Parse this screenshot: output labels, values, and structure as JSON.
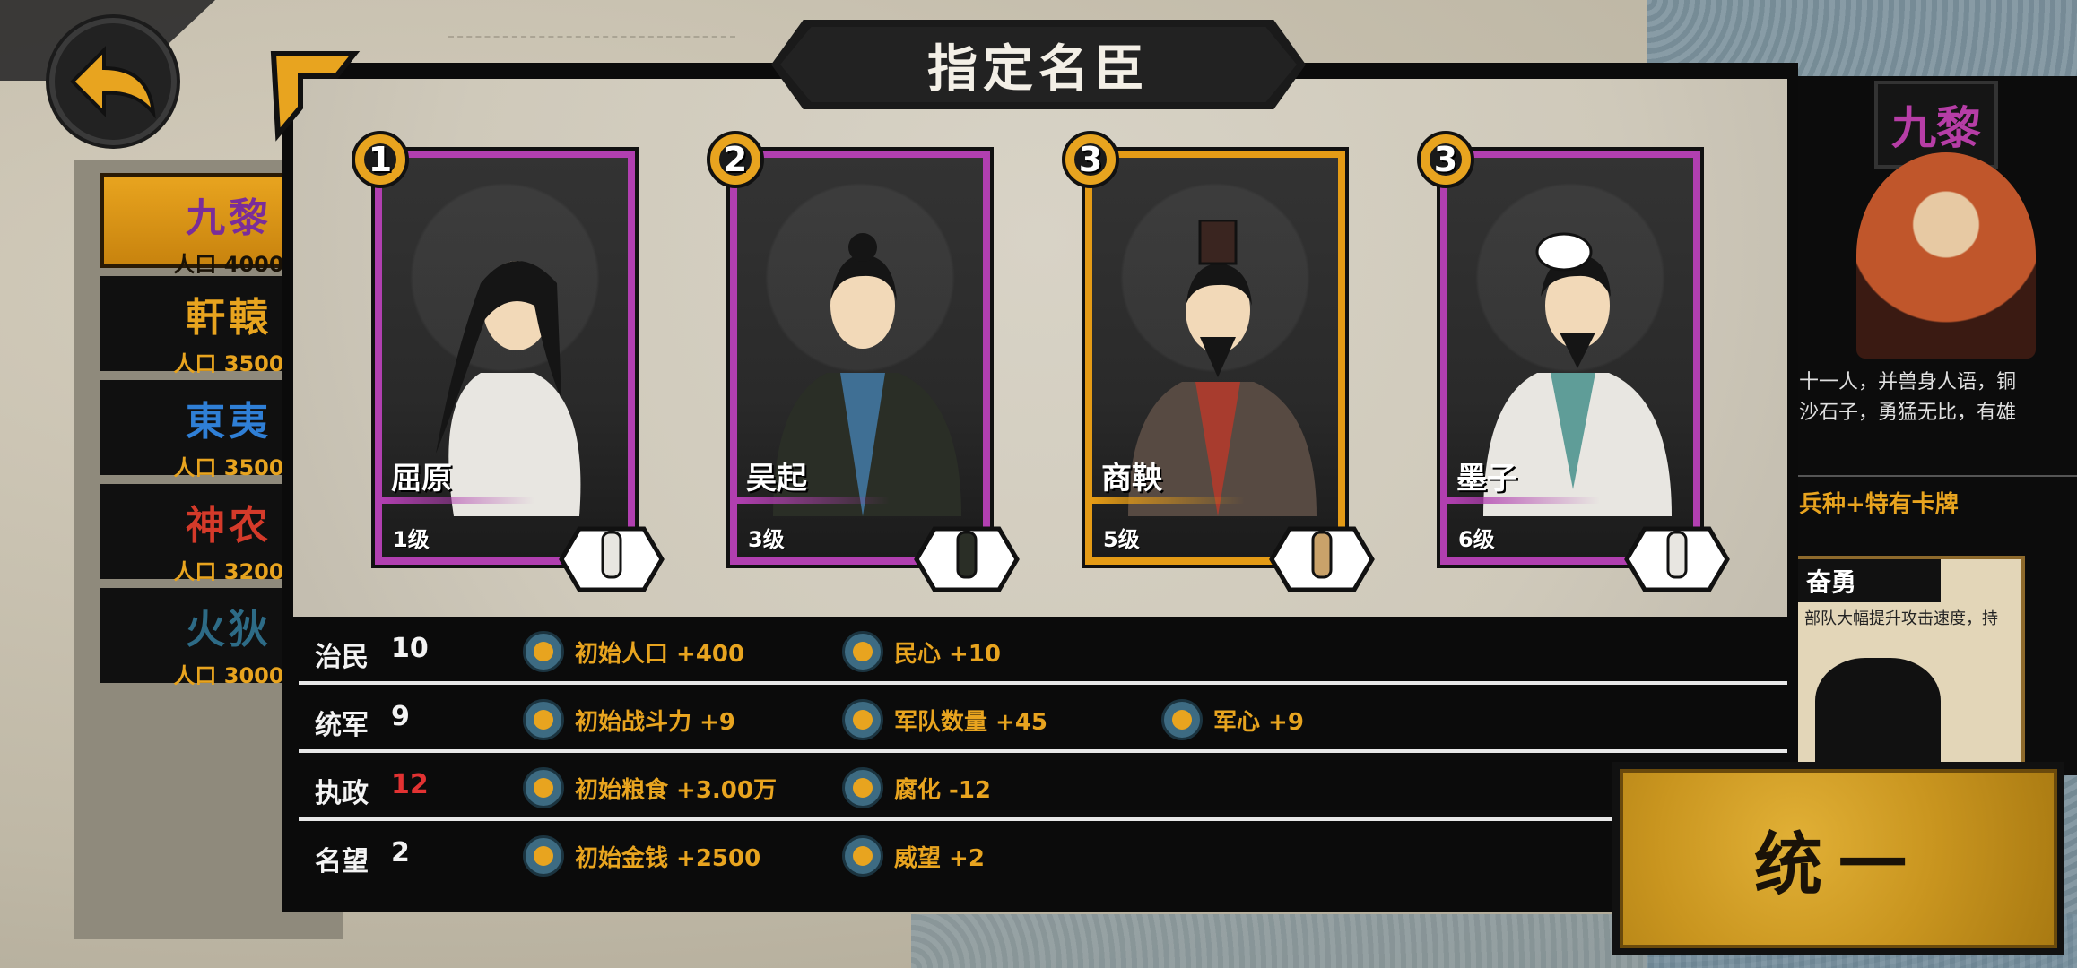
{
  "dialog": {
    "title": "指定名臣"
  },
  "factions": [
    {
      "name": "九黎",
      "population": "人口 4000",
      "color": "#7a2d9a",
      "active": true
    },
    {
      "name": "軒轅",
      "population": "人口 3500",
      "color": "#e8a41f",
      "active": false
    },
    {
      "name": "東夷",
      "population": "人口 3500",
      "color": "#2f7fd6",
      "active": false
    },
    {
      "name": "神农",
      "population": "人口 3200",
      "color": "#d43a2a",
      "active": false
    },
    {
      "name": "火狄",
      "population": "人口 3000",
      "color": "#2d6b86",
      "active": false
    }
  ],
  "ministers": [
    {
      "rank": "1",
      "name": "屈原",
      "level": "1级",
      "frame_color": "#b13fb0"
    },
    {
      "rank": "2",
      "name": "吴起",
      "level": "3级",
      "frame_color": "#b13fb0"
    },
    {
      "rank": "3",
      "name": "商鞅",
      "level": "5级",
      "frame_color": "#e49b16"
    },
    {
      "rank": "3",
      "name": "墨子",
      "level": "6级",
      "frame_color": "#b13fb0"
    }
  ],
  "stats": [
    {
      "label": "治民",
      "value": "10",
      "highlight": false,
      "bonuses": [
        {
          "icon": "population-icon",
          "text": "初始人口  +400"
        },
        {
          "icon": "heart-icon",
          "text": "民心  +10"
        }
      ]
    },
    {
      "label": "统军",
      "value": "9",
      "highlight": false,
      "bonuses": [
        {
          "icon": "sword-power-icon",
          "text": "初始战斗力  +9"
        },
        {
          "icon": "troops-icon",
          "text": "军队数量  +45"
        },
        {
          "icon": "morale-icon",
          "text": "军心  +9"
        }
      ]
    },
    {
      "label": "执政",
      "value": "12",
      "highlight": true,
      "bonuses": [
        {
          "icon": "grain-icon",
          "text": "初始粮食  +3.00万"
        },
        {
          "icon": "corruption-hand-icon",
          "text": "腐化  -12"
        }
      ]
    },
    {
      "label": "名望",
      "value": "2",
      "highlight": false,
      "bonuses": [
        {
          "icon": "coin-icon",
          "text": "初始金钱  +2500"
        },
        {
          "icon": "prestige-icon",
          "text": "威望  +2"
        }
      ]
    }
  ],
  "right_panel": {
    "flag": "九黎",
    "desc_line1": "十一人，并兽身人语，铜",
    "desc_line2": "沙石子，勇猛无比，有雄",
    "feature": "兵种+特有卡牌",
    "card_title": "奋勇",
    "card_text": "部队大幅提升攻击速度，持"
  },
  "unify_button": {
    "label": "统一"
  },
  "colors": {
    "accent": "#e8a41f",
    "purple_frame": "#b13fb0",
    "gold_frame": "#e49b16",
    "value_red": "#e23232"
  }
}
